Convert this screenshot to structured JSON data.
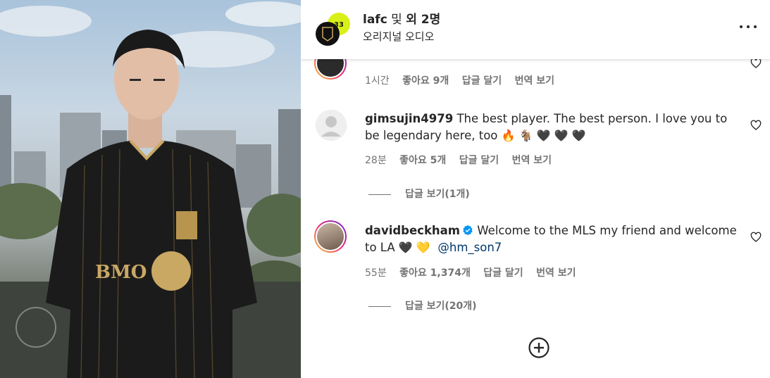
{
  "header": {
    "account": "lafc",
    "connector": " 및 ",
    "others": "외 2명",
    "audio": "오리지널 오디오"
  },
  "comments": [
    {
      "time": "1시간",
      "likes": "좋아요 9개",
      "reply": "답글 달기",
      "translate": "번역 보기"
    },
    {
      "username": "gimsujin4979",
      "text": "The best player. The best person. I love you to be legendary here, too",
      "emojis": "🔥 🐐 🖤 🖤 🖤",
      "time": "28분",
      "likes": "좋아요 5개",
      "reply": "답글 달기",
      "translate": "번역 보기",
      "view_replies": "답글 보기(1개)"
    },
    {
      "username": "davidbeckham",
      "text": "Welcome to the MLS my friend and welcome to LA",
      "emojis": "🖤 💛",
      "mention": "@hm_son7",
      "time": "55분",
      "likes": "좋아요 1,374개",
      "reply": "답글 달기",
      "translate": "번역 보기",
      "view_replies": "답글 보기(20개)"
    }
  ],
  "colors": {
    "accent_link": "#00376b",
    "muted": "#737373",
    "verified": "#0095f6"
  },
  "icons": [
    "more-options-icon",
    "heart-icon",
    "verified-badge-icon",
    "add-comment-icon"
  ]
}
